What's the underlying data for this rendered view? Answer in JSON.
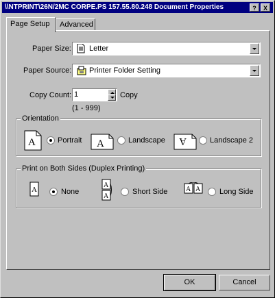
{
  "window": {
    "title": "\\\\NTPRINT\\26N/2MC CORPE.PS 157.55.80.248 Document Properties",
    "help_label": "?",
    "close_label": "X"
  },
  "tabs": [
    {
      "label": "Page Setup"
    },
    {
      "label": "Advanced"
    }
  ],
  "paper_size": {
    "label": "Paper Size:",
    "value": "Letter"
  },
  "paper_source": {
    "label": "Paper Source:",
    "value": "Printer Folder Setting"
  },
  "copy_count": {
    "label": "Copy Count:",
    "value": "1",
    "unit": "Copy",
    "range": "(1 - 999)"
  },
  "orientation": {
    "title": "Orientation",
    "options": [
      {
        "label": "Portrait",
        "icon_letter": "A",
        "selected": true
      },
      {
        "label": "Landscape",
        "icon_letter": "A",
        "selected": false
      },
      {
        "label": "Landscape 2",
        "icon_letter": "A",
        "selected": false
      }
    ]
  },
  "duplex": {
    "title": "Print on Both Sides (Duplex Printing)",
    "options": [
      {
        "label": "None",
        "icon_letter": "A",
        "selected": true
      },
      {
        "label": "Short Side",
        "icon_letter": "A",
        "selected": false
      },
      {
        "label": "Long Side",
        "icon_letter": "A",
        "selected": false
      }
    ]
  },
  "buttons": {
    "ok": "OK",
    "cancel": "Cancel"
  },
  "icons": {
    "paper": "document-icon",
    "source": "printer-folder-icon"
  }
}
